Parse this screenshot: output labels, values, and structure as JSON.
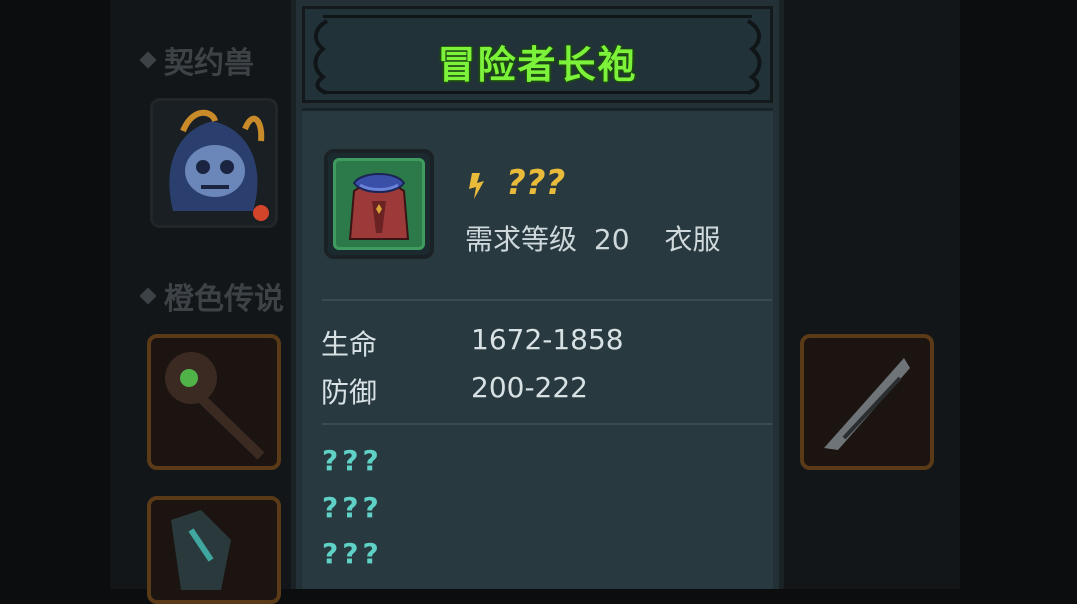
{
  "background": {
    "section_1_label": "契约兽",
    "section_2_label": "橙色传说"
  },
  "tooltip": {
    "title": "冒险者长袍",
    "title_color": "#7df23a",
    "item_icon": "robe-icon",
    "class_icon": "class-glyph-icon",
    "quality": "???",
    "required_level_label": "需求等级",
    "required_level": "20",
    "item_type": "衣服",
    "stats": [
      {
        "name": "生命",
        "value": "1672-1858"
      },
      {
        "name": "防御",
        "value": "200-222"
      }
    ],
    "unknown_affixes": [
      "???",
      "???",
      "???"
    ],
    "unknown_color": "#5fd1c6"
  }
}
